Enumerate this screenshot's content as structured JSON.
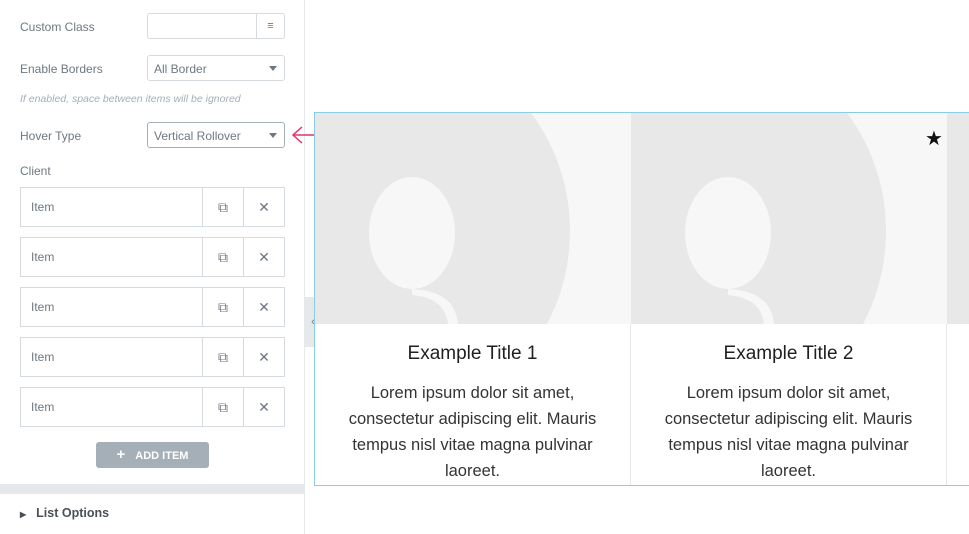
{
  "panel": {
    "custom_class": {
      "label": "Custom Class",
      "value": "",
      "icon": "database-icon"
    },
    "enable_borders": {
      "label": "Enable Borders",
      "value": "All Border"
    },
    "hint": "If enabled, space between items will be ignored",
    "hover_type": {
      "label": "Hover Type",
      "value": "Vertical Rollover"
    },
    "client_label": "Client",
    "items": [
      {
        "label": "Item"
      },
      {
        "label": "Item"
      },
      {
        "label": "Item"
      },
      {
        "label": "Item"
      },
      {
        "label": "Item"
      }
    ],
    "add_item": "ADD ITEM",
    "list_options": "List Options"
  },
  "accent": "#e2336b",
  "cards": [
    {
      "title": "Example Title 1",
      "text": "Lorem ipsum dolor sit amet, consectetur adipiscing elit. Mauris tempus nisl vitae magna pulvinar laoreet."
    },
    {
      "title": "Example Title 2",
      "text": "Lorem ipsum dolor sit amet, consectetur adipiscing elit. Mauris tempus nisl vitae magna pulvinar laoreet."
    }
  ]
}
